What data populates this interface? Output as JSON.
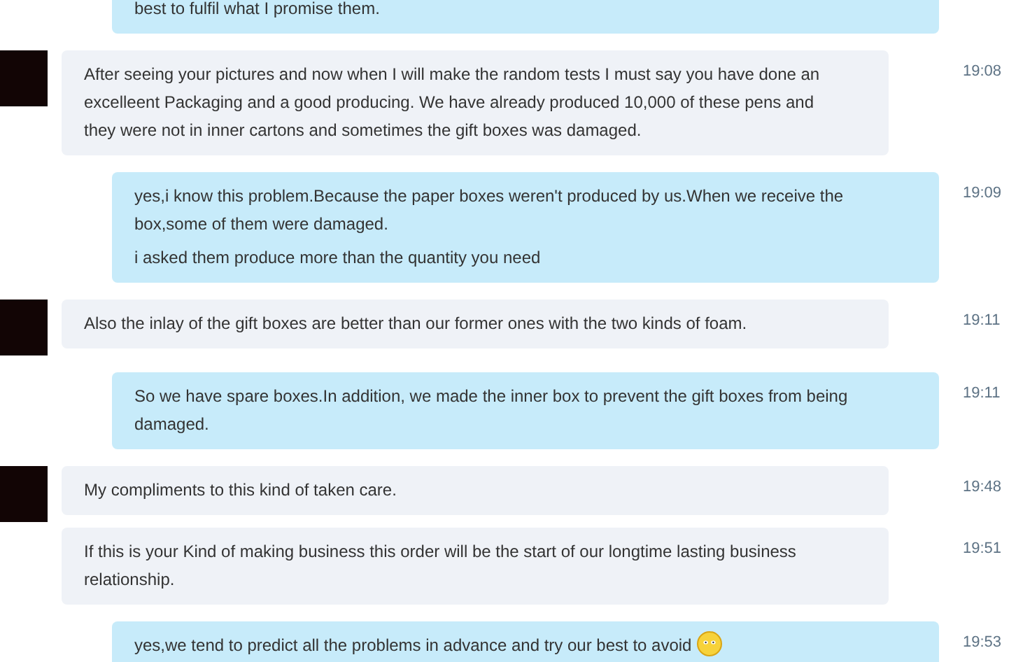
{
  "messages": [
    {
      "kind": "outgoing",
      "emoji": false,
      "paragraphs": [
        "best to fulfil what I promise them."
      ]
    },
    {
      "kind": "incoming",
      "avatar": true,
      "emoji": false,
      "time": "19:08",
      "paragraphs": [
        "After seeing your pictures and now when I will make the random tests I must say you have done an excelleent Packaging and a good producing. We have already produced 10,000 of these pens and they were not in inner cartons and sometimes the gift boxes was damaged."
      ]
    },
    {
      "kind": "outgoing",
      "emoji": false,
      "time": "19:09",
      "paragraphs": [
        "yes,i know this problem.Because the paper boxes weren't produced by us.When we receive the box,some of them were damaged.",
        "i asked them produce more than the quantity you need"
      ]
    },
    {
      "kind": "incoming",
      "avatar": true,
      "emoji": false,
      "time": "19:11",
      "paragraphs": [
        "Also the inlay of the gift boxes are better than our former ones with the two kinds of foam."
      ]
    },
    {
      "kind": "outgoing",
      "emoji": false,
      "time": "19:11",
      "paragraphs": [
        "So we have spare boxes.In addition, we made the inner box to prevent the gift boxes from being damaged."
      ]
    },
    {
      "kind": "incoming",
      "avatar": true,
      "emoji": false,
      "time": "19:48",
      "paragraphs": [
        "My compliments to this kind of taken care."
      ]
    },
    {
      "kind": "incoming",
      "avatar": false,
      "emoji": false,
      "time": "19:51",
      "paragraphs": [
        "If this is your Kind of making business this order will be the start of our longtime lasting business relationship."
      ]
    },
    {
      "kind": "outgoing",
      "emoji": true,
      "time": "19:53",
      "paragraphs": [
        "yes,we tend to predict all the problems in advance and try our best to avoid"
      ]
    }
  ]
}
